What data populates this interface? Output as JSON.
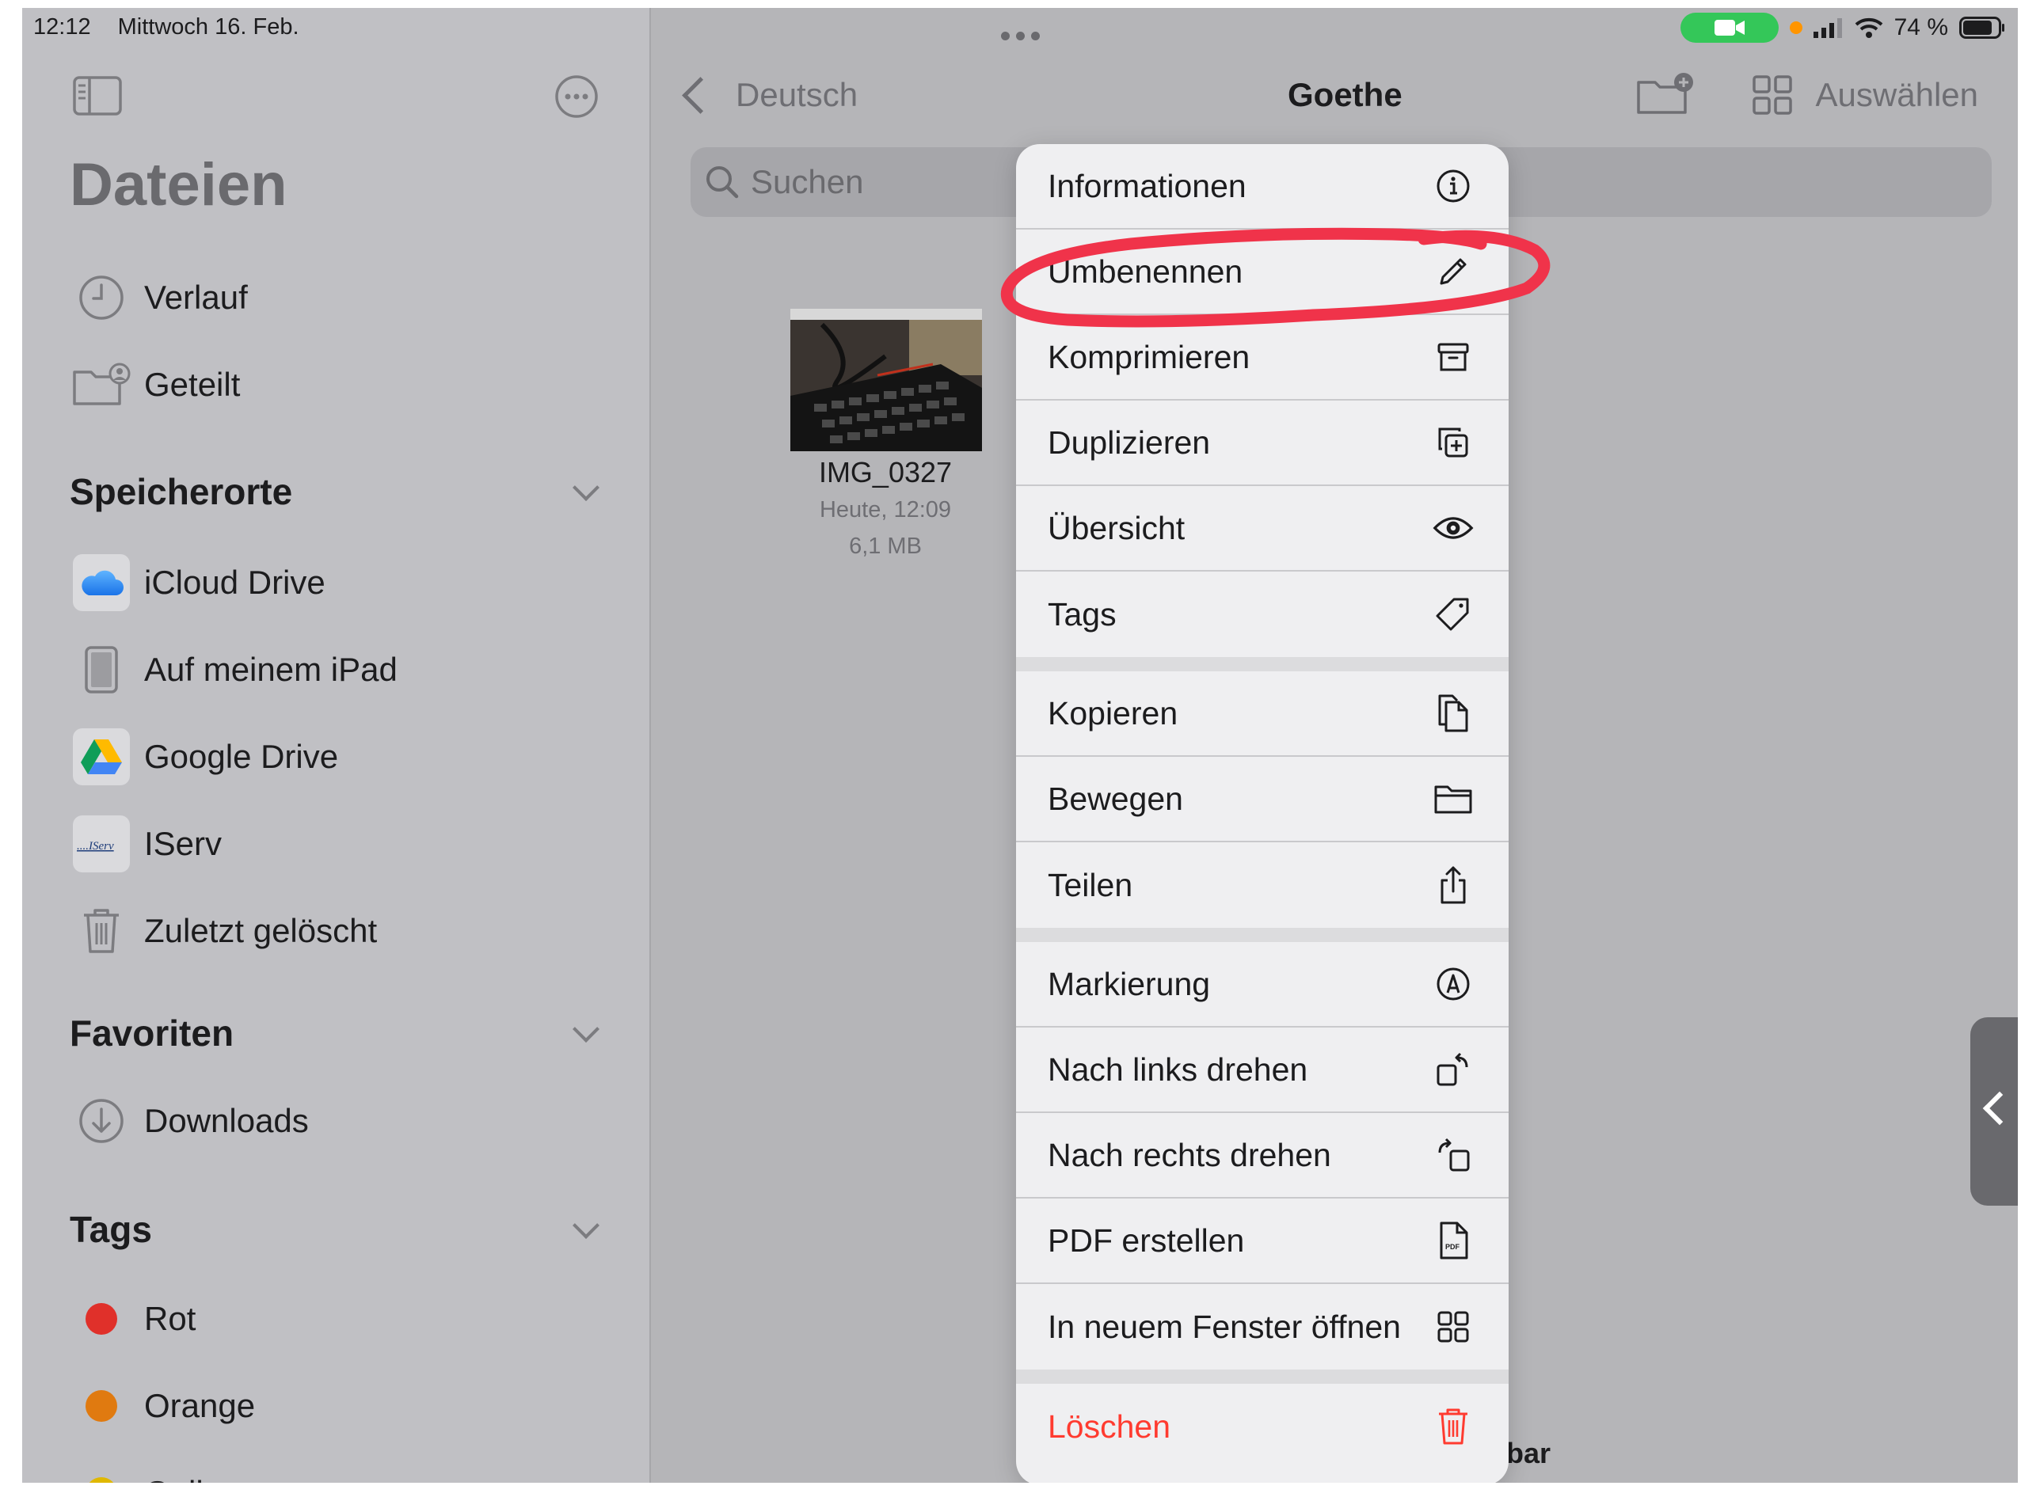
{
  "status_bar": {
    "time": "12:12",
    "date": "Mittwoch 16. Feb.",
    "battery": "74 %"
  },
  "sidebar": {
    "title": "Dateien",
    "top_items": [
      {
        "label": "Verlauf",
        "icon": "clock-icon"
      },
      {
        "label": "Geteilt",
        "icon": "shared-folder-icon"
      }
    ],
    "locations": {
      "title": "Speicherorte",
      "items": [
        {
          "label": "iCloud Drive",
          "icon": "icloud-icon"
        },
        {
          "label": "Auf meinem iPad",
          "icon": "ipad-icon"
        },
        {
          "label": "Google Drive",
          "icon": "google-drive-icon"
        },
        {
          "label": "IServ",
          "icon": "iserv-icon",
          "logo_text": "IServ"
        },
        {
          "label": "Zuletzt gelöscht",
          "icon": "trash-icon"
        }
      ]
    },
    "favorites": {
      "title": "Favoriten",
      "items": [
        {
          "label": "Downloads",
          "icon": "download-icon"
        }
      ]
    },
    "tags": {
      "title": "Tags",
      "items": [
        {
          "label": "Rot",
          "color": "#e0302a"
        },
        {
          "label": "Orange",
          "color": "#e07a10"
        },
        {
          "label": "Gelb",
          "color": "#e0b800"
        }
      ]
    }
  },
  "navigation": {
    "back_label": "Deutsch",
    "title": "Goethe",
    "select_label": "Auswählen"
  },
  "search": {
    "placeholder": "Suchen"
  },
  "file": {
    "name": "IMG_0327",
    "date": "Heute, 12:09",
    "size": "6,1 MB"
  },
  "background_text": "bar",
  "context_menu": {
    "groups": [
      [
        {
          "label": "Informationen",
          "icon": "info-icon"
        },
        {
          "label": "Umbenennen",
          "icon": "pencil-icon"
        },
        {
          "label": "Komprimieren",
          "icon": "archive-box-icon"
        },
        {
          "label": "Duplizieren",
          "icon": "duplicate-icon"
        },
        {
          "label": "Übersicht",
          "icon": "eye-icon"
        },
        {
          "label": "Tags",
          "icon": "tag-icon"
        }
      ],
      [
        {
          "label": "Kopieren",
          "icon": "copy-icon"
        },
        {
          "label": "Bewegen",
          "icon": "folder-icon"
        },
        {
          "label": "Teilen",
          "icon": "share-icon"
        }
      ],
      [
        {
          "label": "Markierung",
          "icon": "markup-icon"
        },
        {
          "label": "Nach links drehen",
          "icon": "rotate-left-icon"
        },
        {
          "label": "Nach rechts drehen",
          "icon": "rotate-right-icon"
        },
        {
          "label": "PDF erstellen",
          "icon": "pdf-icon"
        },
        {
          "label": "In neuem Fenster öffnen",
          "icon": "new-window-icon"
        }
      ],
      [
        {
          "label": "Löschen",
          "icon": "trash-icon",
          "destructive": true
        }
      ]
    ],
    "highlight_color": "#f0334a"
  },
  "colors": {
    "accent_green": "#34c759",
    "destructive": "#ff3b30",
    "menu_bg": "#efeff1"
  }
}
